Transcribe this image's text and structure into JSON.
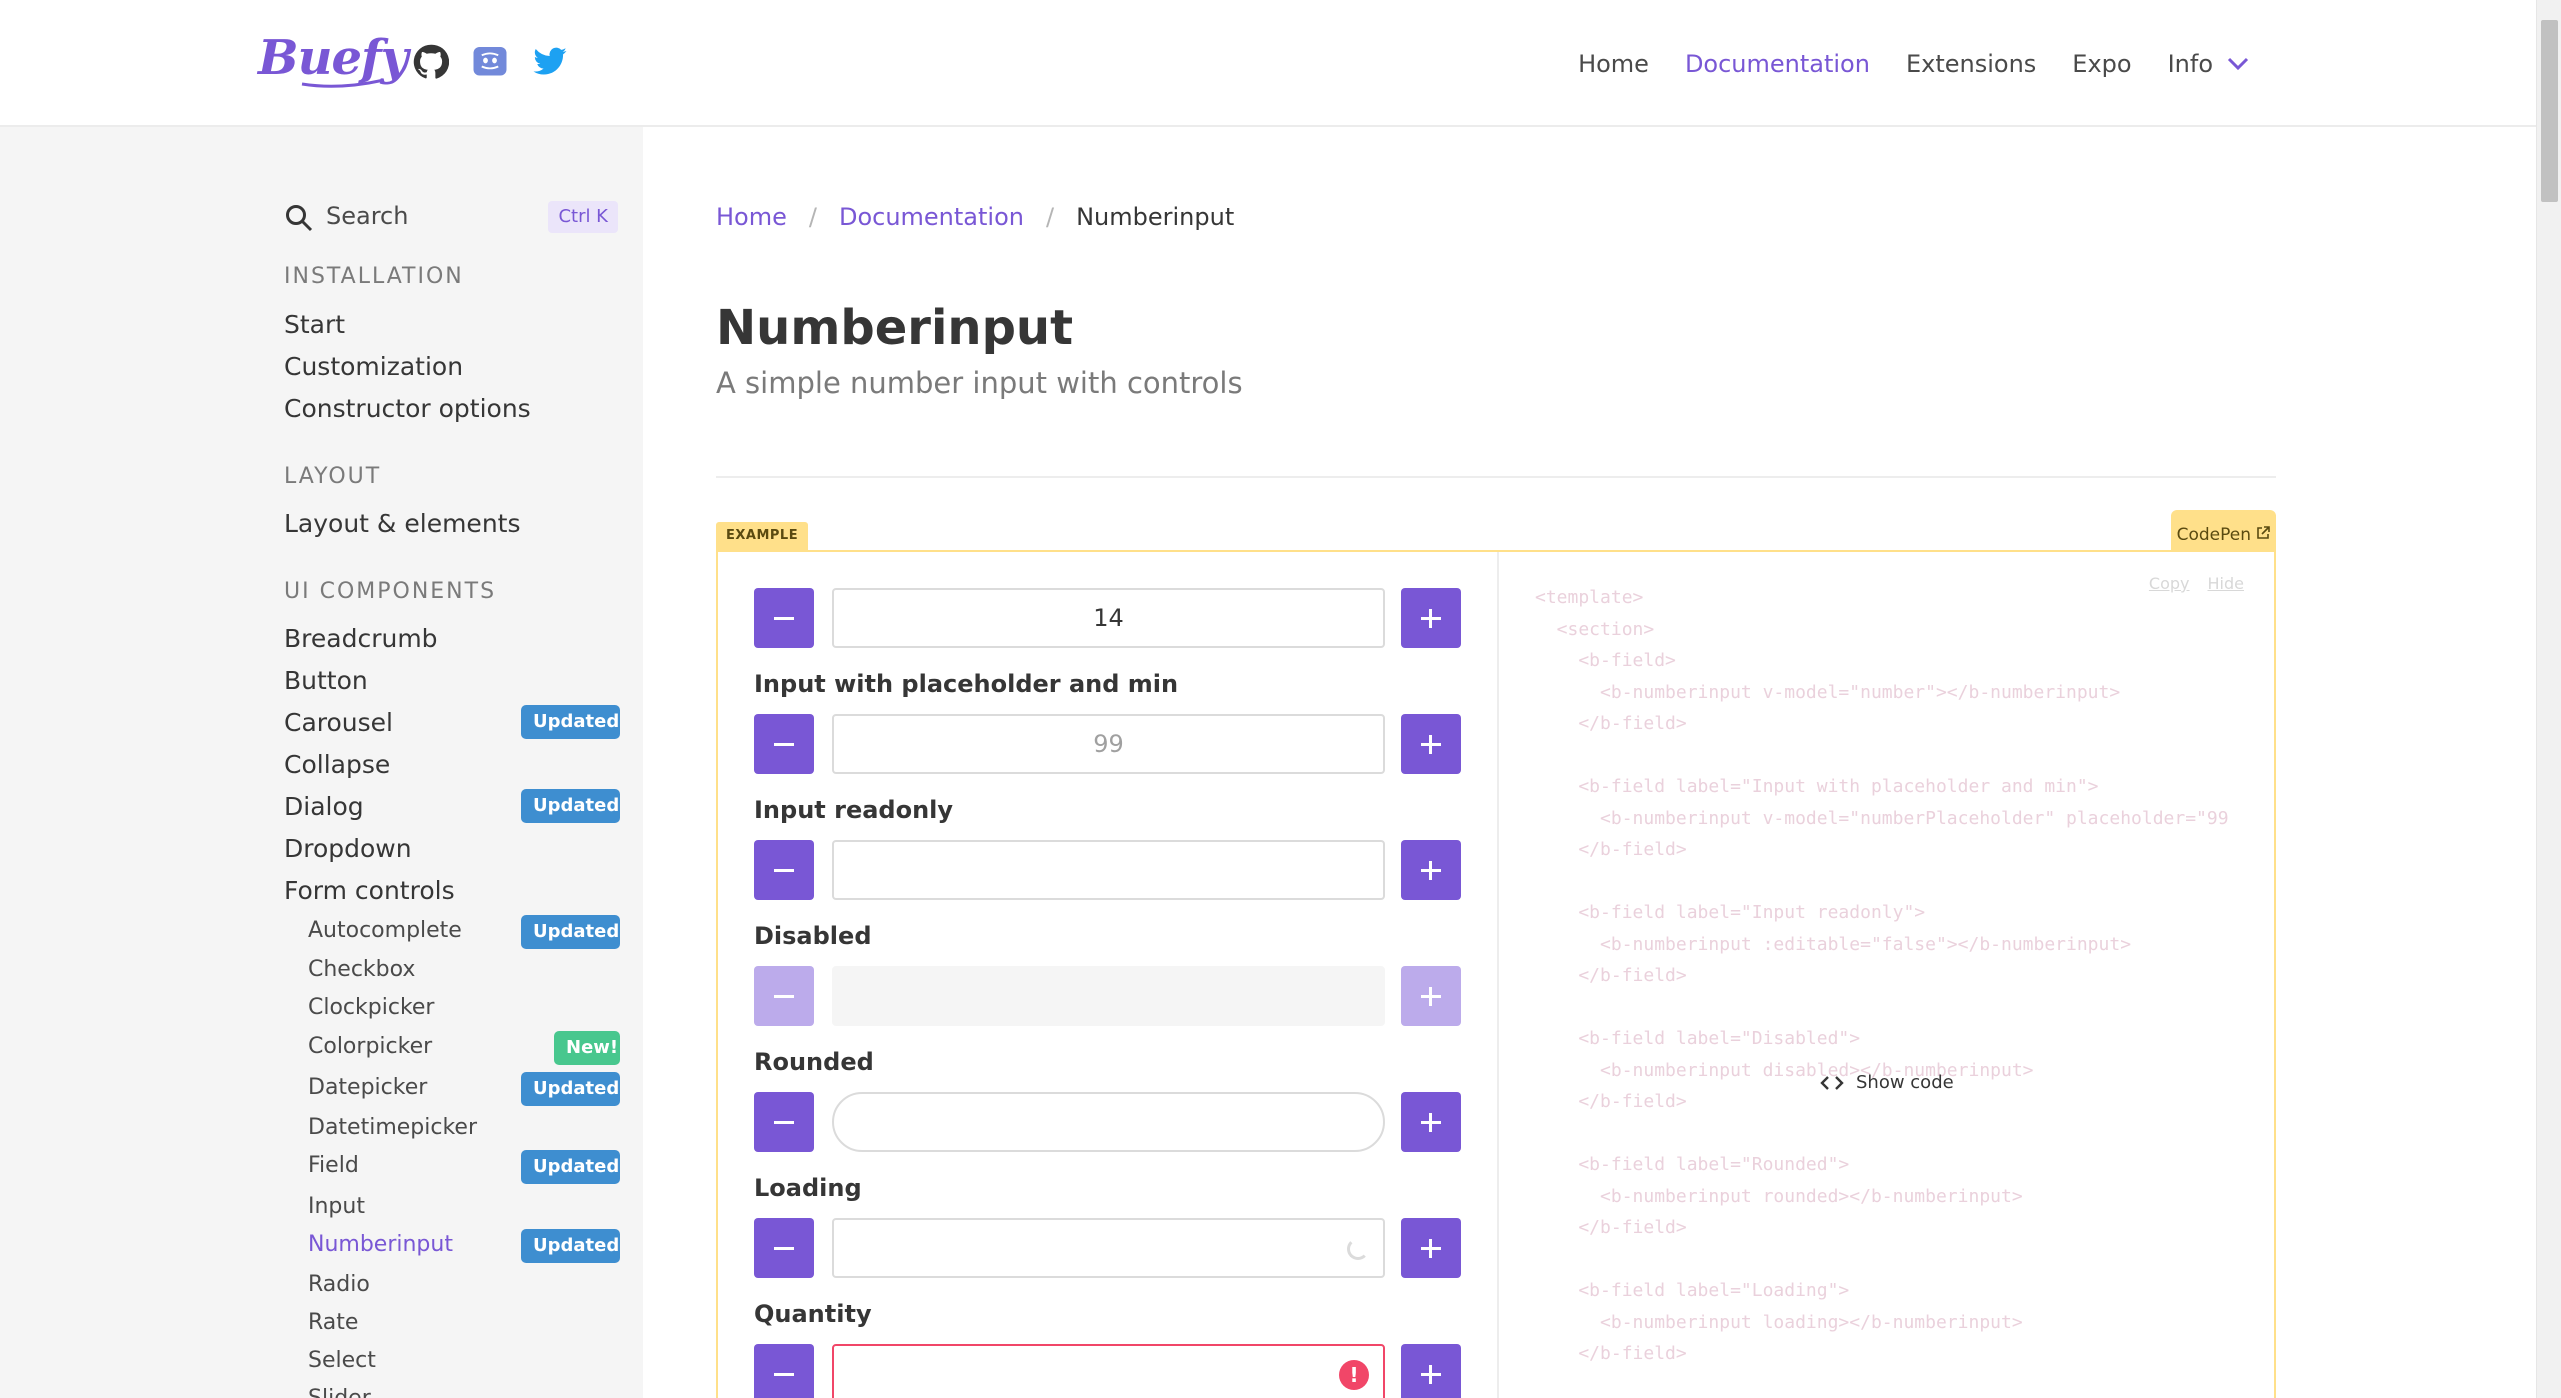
{
  "brand": {
    "name": "Buefy",
    "accent": "#7957d5",
    "social": [
      "github-icon",
      "discord-icon",
      "twitter-icon"
    ]
  },
  "nav": {
    "home": "Home",
    "documentation": "Documentation",
    "extensions": "Extensions",
    "expo": "Expo",
    "info": "Info"
  },
  "sidebar": {
    "search": {
      "label": "Search",
      "shortcut": "Ctrl K"
    },
    "sections": {
      "installation": "INSTALLATION",
      "layout": "LAYOUT",
      "ui_components": "UI COMPONENTS"
    },
    "installation_items": [
      "Start",
      "Customization",
      "Constructor options"
    ],
    "layout_items": [
      "Layout & elements"
    ],
    "component_items": [
      {
        "label": "Breadcrumb",
        "tag": ""
      },
      {
        "label": "Button",
        "tag": ""
      },
      {
        "label": "Carousel",
        "tag": "Updated"
      },
      {
        "label": "Collapse",
        "tag": ""
      },
      {
        "label": "Dialog",
        "tag": "Updated"
      },
      {
        "label": "Dropdown",
        "tag": ""
      },
      {
        "label": "Form controls",
        "tag": ""
      }
    ],
    "form_controls": [
      {
        "label": "Autocomplete",
        "tag": "Updated"
      },
      {
        "label": "Checkbox",
        "tag": ""
      },
      {
        "label": "Clockpicker",
        "tag": ""
      },
      {
        "label": "Colorpicker",
        "tag": "New!"
      },
      {
        "label": "Datepicker",
        "tag": "Updated"
      },
      {
        "label": "Datetimepicker",
        "tag": ""
      },
      {
        "label": "Field",
        "tag": "Updated"
      },
      {
        "label": "Input",
        "tag": ""
      },
      {
        "label": "Numberinput",
        "tag": "Updated",
        "active": true
      },
      {
        "label": "Radio",
        "tag": ""
      },
      {
        "label": "Rate",
        "tag": ""
      },
      {
        "label": "Select",
        "tag": ""
      },
      {
        "label": "Slider",
        "tag": ""
      }
    ]
  },
  "breadcrumb": {
    "home": "Home",
    "documentation": "Documentation",
    "current": "Numberinput",
    "separator": "/"
  },
  "page": {
    "title": "Numberinput",
    "subtitle": "A simple number input with controls"
  },
  "example": {
    "tag": "EXAMPLE",
    "codepen": "CodePen",
    "fields": [
      {
        "label": "",
        "value": "14",
        "placeholder": ""
      },
      {
        "label": "Input with placeholder and min",
        "value": "",
        "placeholder": "99"
      },
      {
        "label": "Input readonly",
        "value": "",
        "placeholder": ""
      },
      {
        "label": "Disabled",
        "value": "",
        "placeholder": ""
      },
      {
        "label": "Rounded",
        "value": "",
        "placeholder": ""
      },
      {
        "label": "Loading",
        "value": "",
        "placeholder": ""
      },
      {
        "label": "Quantity",
        "value": "",
        "placeholder": ""
      }
    ],
    "code_actions": {
      "copy": "Copy",
      "hide": "Hide"
    },
    "show_code": "Show code",
    "code_lines": [
      "<template>",
      "  <section>",
      "    <b-field>",
      "      <b-numberinput v-model=\"number\"></b-numberinput>",
      "    </b-field>",
      "",
      "    <b-field label=\"Input with placeholder and min\">",
      "      <b-numberinput v-model=\"numberPlaceholder\" placeholder=\"99",
      "    </b-field>",
      "",
      "    <b-field label=\"Input readonly\">",
      "      <b-numberinput :editable=\"false\"></b-numberinput>",
      "    </b-field>",
      "",
      "    <b-field label=\"Disabled\">",
      "      <b-numberinput disabled></b-numberinput>",
      "    </b-field>",
      "",
      "    <b-field label=\"Rounded\">",
      "      <b-numberinput rounded></b-numberinput>",
      "    </b-field>",
      "",
      "    <b-field label=\"Loading\">",
      "      <b-numberinput loading></b-numberinput>",
      "    </b-field>"
    ]
  }
}
